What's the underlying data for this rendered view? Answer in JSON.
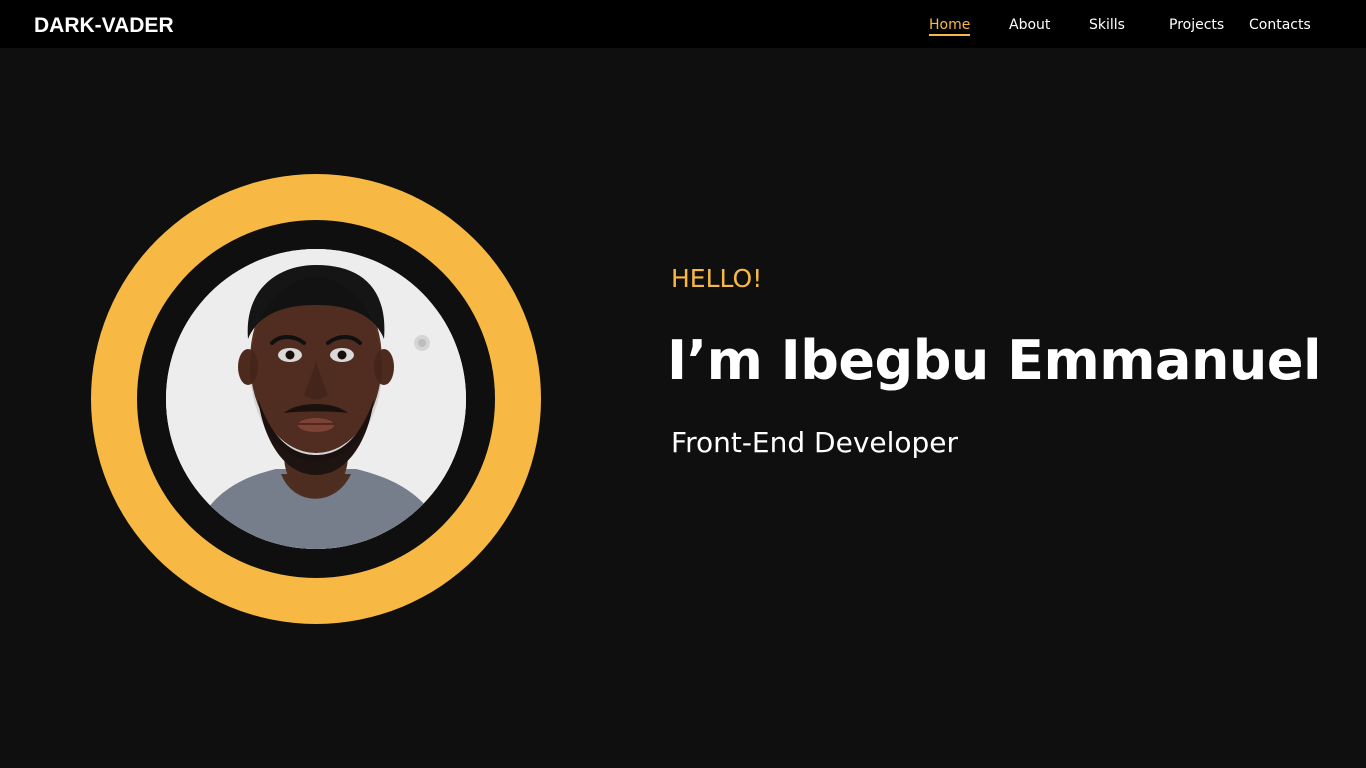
{
  "brand": "DARK-VADER",
  "nav": {
    "home": "Home",
    "about": "About",
    "skills": "Skills",
    "projects": "Projects",
    "contacts": "Contacts",
    "active": "Home"
  },
  "hero": {
    "greeting": "HELLO!",
    "headline": "I’m Ibegbu Emmanuel",
    "role": "Front-End Developer"
  },
  "colors": {
    "accent": "#f8b944",
    "background": "#0f0f10",
    "navbar": "#000000",
    "text": "#ffffff"
  },
  "icons": {
    "avatar": "profile-photo"
  }
}
